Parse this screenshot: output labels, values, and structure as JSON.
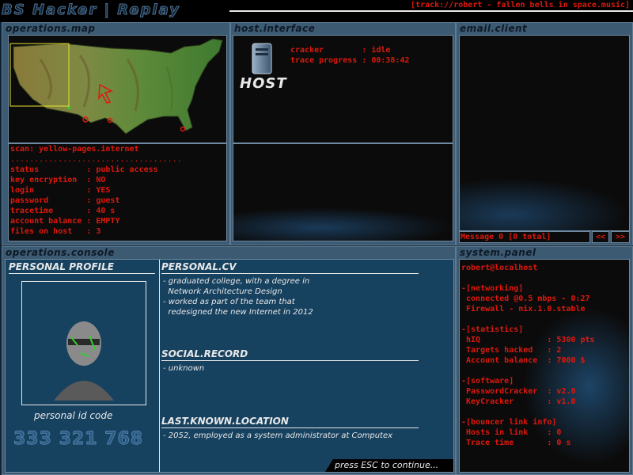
{
  "app_title": "BS Hacker | Replay",
  "track": "[track://robert - fallen bells in space.music]",
  "panels": {
    "operations_map": "operations.map",
    "host_interface": "host.interface",
    "email_client": "email.client",
    "operations_console": "operations.console",
    "system_panel": "system.panel"
  },
  "scan": {
    "title": "scan: yellow-pages.internet",
    "separator": "....................................",
    "rows": [
      {
        "label": "status          ",
        "value": ": public access"
      },
      {
        "label": "key encryption  ",
        "value": ": NO"
      },
      {
        "label": "login           ",
        "value": ": YES"
      },
      {
        "label": "password        ",
        "value": ": guest"
      },
      {
        "label": "tracetime       ",
        "value": ": 40 s"
      },
      {
        "label": "account balance ",
        "value": ": EMPTY"
      },
      {
        "label": "files on host   ",
        "value": ": 3"
      }
    ]
  },
  "host": {
    "label": "HOST",
    "rows": [
      {
        "label": "cracker        ",
        "value": ": idle"
      },
      {
        "label": "trace progress ",
        "value": ": 00:38:42"
      }
    ]
  },
  "email": {
    "status": "Message 0 [0 total]",
    "prev": "<<",
    "next": ">>"
  },
  "profile": {
    "title": "PERSONAL PROFILE",
    "id_label": "personal id code",
    "id_code": "333 321 768"
  },
  "cv": {
    "title": "PERSONAL.CV",
    "lines": [
      "- graduated college, with a degree in",
      "  Network Architecture Design",
      "- worked as part of the team that",
      "  redesigned the new Internet in 2012"
    ]
  },
  "social": {
    "title": "SOCIAL.RECORD",
    "lines": [
      "- unknown"
    ]
  },
  "location": {
    "title": "LAST.KNOWN.LOCATION",
    "lines": [
      "- 2052, employed as a system administrator at Computex"
    ]
  },
  "continue_prompt": "press ESC to continue...",
  "system": {
    "user": "robert@localhost",
    "sections": [
      {
        "header": "-[networking]",
        "lines": [
          " connected @0.5 mbps - 0:27",
          " Firewall - nix.1.0.stable"
        ]
      },
      {
        "header": "-[statistics]",
        "lines": [
          " hIQ              : 5300 pts",
          " Targets hacked   : 2",
          " Account balance  : 7000 $"
        ]
      },
      {
        "header": "-[software]",
        "lines": [
          " PasswordCracker  : v2.0",
          " KeyCracker       : v1.0"
        ]
      },
      {
        "header": "-[bouncer link info]",
        "lines": [
          " Hosts in link    : 0",
          " Trace time       : 0 s"
        ]
      }
    ]
  },
  "colors": {
    "terminal_red": "#e0180c",
    "panel_frame": "#3d5a73",
    "console_bg": "#16415f",
    "map_selection": "#e8e030"
  }
}
